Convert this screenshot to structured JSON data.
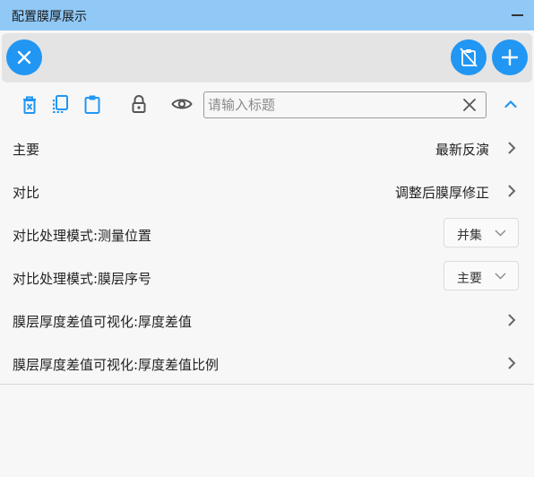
{
  "window": {
    "title": "配置膜厚展示"
  },
  "toolbar": {
    "close_button_icon": "close-icon",
    "clipboard_off_icon": "clipboard-off-icon",
    "add_icon": "plus-icon"
  },
  "actions": {
    "search": {
      "placeholder": "请输入标题",
      "value": ""
    },
    "icons": [
      "delete-doc-icon",
      "copy-icon",
      "clipboard-icon",
      "lock-icon",
      "eye-icon",
      "clear-icon",
      "chevron-up-icon"
    ]
  },
  "settings": [
    {
      "label": "主要",
      "value": "最新反演",
      "control": "link"
    },
    {
      "label": "对比",
      "value": "调整后膜厚修正",
      "control": "link"
    },
    {
      "label": "对比处理模式:测量位置",
      "value": "并集",
      "control": "select"
    },
    {
      "label": "对比处理模式:膜层序号",
      "value": "主要",
      "control": "select"
    },
    {
      "label": "膜层厚度差值可视化:厚度差值",
      "value": "",
      "control": "link"
    },
    {
      "label": "膜层厚度差值可视化:厚度差值比例",
      "value": "",
      "control": "link"
    }
  ],
  "colors": {
    "accent": "#2196f3",
    "titlebar": "#90c8f6"
  }
}
